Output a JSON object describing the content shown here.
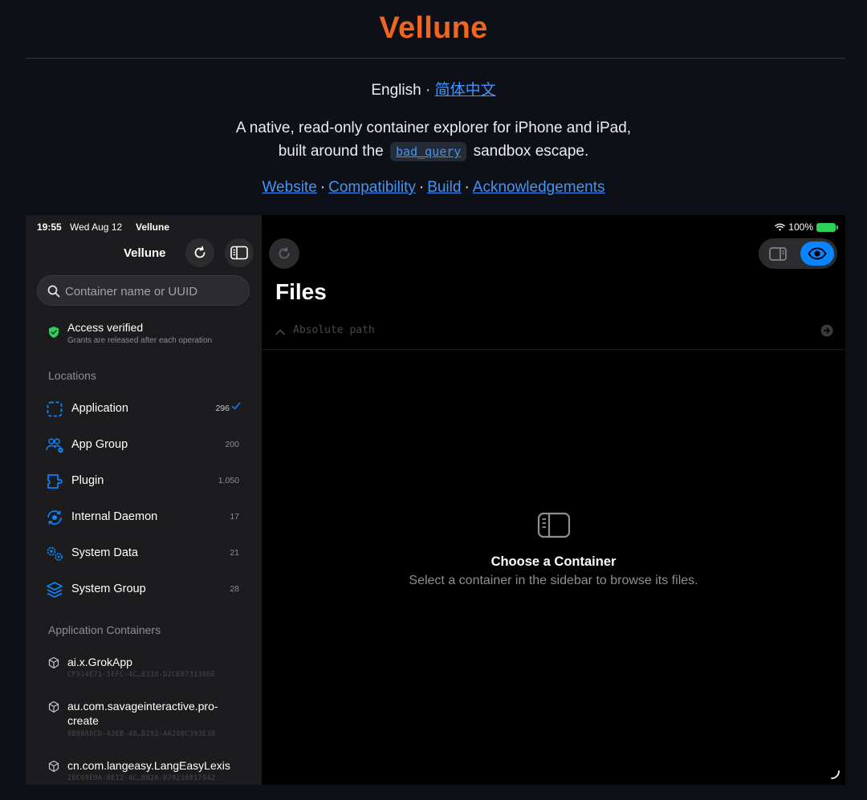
{
  "readme": {
    "title": "Vellune",
    "lang_current": "English",
    "lang_sep": " · ",
    "lang_other": "简体中文",
    "tagline_line1": "A native, read-only container explorer for iPhone and iPad,",
    "tagline_pre": "built around the",
    "tagline_code": "bad_query",
    "tagline_post": "sandbox escape.",
    "links": [
      "Website",
      "Compatibility",
      "Build",
      "Acknowledgements"
    ],
    "link_sep": "·",
    "link_color": "#4493f8",
    "title_color": "#f0651f"
  },
  "status": {
    "time": "19:55",
    "date": "Wed Aug 12",
    "app": "Vellune",
    "battery": "100%"
  },
  "sidebar": {
    "title": "Vellune",
    "search_placeholder": "Container name or UUID",
    "access_title": "Access verified",
    "access_subtitle": "Grants are released after each operation",
    "locations_header": "Locations",
    "locations": [
      {
        "label": "Application",
        "count": "296",
        "icon": "dashed-square-icon",
        "selected": true
      },
      {
        "label": "App Group",
        "count": "200",
        "icon": "people-group-icon"
      },
      {
        "label": "Plugin",
        "count": "1,050",
        "icon": "puzzle-plug-icon"
      },
      {
        "label": "Internal Daemon",
        "count": "17",
        "icon": "daemon-cycle-icon"
      },
      {
        "label": "System Data",
        "count": "21",
        "icon": "gears-icon"
      },
      {
        "label": "System Group",
        "count": "28",
        "icon": "stack-layers-icon"
      }
    ],
    "containers_header": "Application Containers",
    "containers": [
      {
        "name": "ai.x.GrokApp",
        "uuid": "CF914E71-5EFC-4C…8338-D2CE8731366E"
      },
      {
        "name": "au.com.savageinteractive.pro-create",
        "uuid": "0B88A8CD-43EB-40…B192-AA288C393E38"
      },
      {
        "name": "cn.com.langeasy.LangEasyLexis",
        "uuid": "26C69E9A-0E12-4C…B82A-D70216817942"
      }
    ]
  },
  "main": {
    "title": "Files",
    "path_placeholder": "Absolute path",
    "empty_title": "Choose a Container",
    "empty_subtitle": "Select a container in the sidebar to browse its files.",
    "accent": "#0a84ff"
  }
}
